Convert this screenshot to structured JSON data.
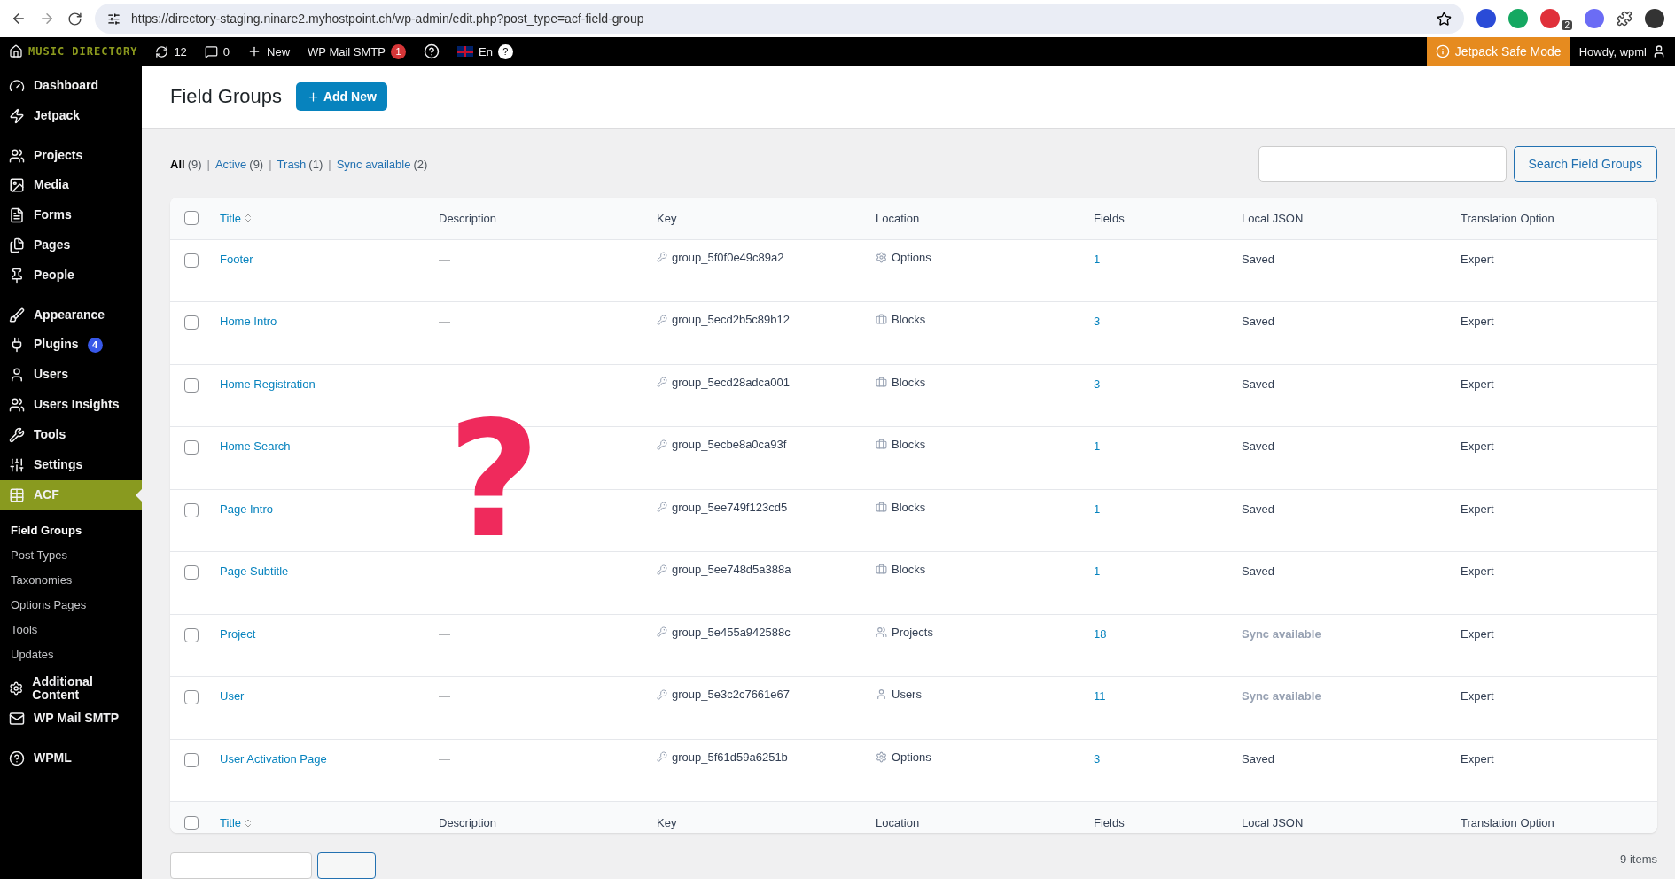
{
  "browser": {
    "url": "https://directory-staging.ninare2.myhostpoint.ch/wp-admin/edit.php?post_type=acf-field-group",
    "extension_badge": "2"
  },
  "admin_bar": {
    "site": "MUSIC DIRECTORY",
    "updates": "12",
    "comments": "0",
    "new": "New",
    "smtp": "WP Mail SMTP",
    "smtp_badge": "1",
    "language": "En",
    "help": "?",
    "safe_mode": "Jetpack Safe Mode",
    "howdy": "Howdy, wpml"
  },
  "sidebar": {
    "items": [
      {
        "label": "Dashboard",
        "selected": false,
        "group_start": false
      },
      {
        "label": "Jetpack",
        "selected": false,
        "group_start": false
      },
      {
        "label": "Projects",
        "selected": false,
        "group_start": true
      },
      {
        "label": "Media",
        "selected": false,
        "group_start": false
      },
      {
        "label": "Forms",
        "selected": false,
        "group_start": false
      },
      {
        "label": "Pages",
        "selected": false,
        "group_start": false
      },
      {
        "label": "People",
        "selected": false,
        "group_start": false
      },
      {
        "label": "Appearance",
        "selected": false,
        "group_start": true
      },
      {
        "label": "Plugins",
        "selected": false,
        "group_start": false,
        "badge": "4"
      },
      {
        "label": "Users",
        "selected": false,
        "group_start": false
      },
      {
        "label": "Users Insights",
        "selected": false,
        "group_start": false
      },
      {
        "label": "Tools",
        "selected": false,
        "group_start": false
      },
      {
        "label": "Settings",
        "selected": false,
        "group_start": false
      },
      {
        "label": "ACF",
        "selected": true,
        "group_start": false,
        "children": [
          {
            "label": "Field Groups",
            "selected": true
          },
          {
            "label": "Post Types",
            "selected": false
          },
          {
            "label": "Taxonomies",
            "selected": false
          },
          {
            "label": "Options Pages",
            "selected": false
          },
          {
            "label": "Tools",
            "selected": false
          },
          {
            "label": "Updates",
            "selected": false
          }
        ]
      },
      {
        "label": "Additional Content",
        "selected": false,
        "group_start": false
      },
      {
        "label": "WP Mail SMTP",
        "selected": false,
        "group_start": false
      },
      {
        "label": "WPML",
        "selected": false,
        "group_start": true
      }
    ]
  },
  "header": {
    "title": "Field Groups",
    "add_button": "Add New"
  },
  "filters": [
    {
      "label": "All",
      "count": "(9)",
      "selected": true
    },
    {
      "separator": "|",
      "label": "Active",
      "count": "(9)",
      "selected": false
    },
    {
      "separator": "|",
      "label": "Trash",
      "count": "(1)",
      "selected": false
    },
    {
      "separator": "|",
      "label": "Sync available",
      "count": "(2)",
      "selected": false
    }
  ],
  "search": {
    "button": "Search Field Groups"
  },
  "table": {
    "select_all_checked": false,
    "columns": [
      "Title",
      "Description",
      "Key",
      "Location",
      "Fields",
      "Local JSON",
      "Translation Option"
    ],
    "rows": [
      {
        "title": "Footer",
        "description": "—",
        "key": "group_5f0f0e49c89a2",
        "location": {
          "label": "Options",
          "kind": "options"
        },
        "fields": "1",
        "local_json": {
          "label": "Saved",
          "dimmed": false
        },
        "translation": "Expert",
        "checked": false
      },
      {
        "title": "Home Intro",
        "description": "—",
        "key": "group_5ecd2b5c89b12",
        "location": {
          "label": "Blocks",
          "kind": "blocks"
        },
        "fields": "3",
        "local_json": {
          "label": "Saved",
          "dimmed": false
        },
        "translation": "Expert",
        "checked": false
      },
      {
        "title": "Home Registration",
        "description": "—",
        "key": "group_5ecd28adca001",
        "location": {
          "label": "Blocks",
          "kind": "blocks"
        },
        "fields": "3",
        "local_json": {
          "label": "Saved",
          "dimmed": false
        },
        "translation": "Expert",
        "checked": false
      },
      {
        "title": "Home Search",
        "key": "group_5ecbe8a0ca93f",
        "location": {
          "label": "Blocks",
          "kind": "blocks"
        },
        "fields": "1",
        "local_json": {
          "label": "Saved",
          "dimmed": false
        },
        "translation": "Expert",
        "checked": false
      },
      {
        "title": "Page Intro",
        "description": "—",
        "key": "group_5ee749f123cd5",
        "location": {
          "label": "Blocks",
          "kind": "blocks"
        },
        "fields": "1",
        "local_json": {
          "label": "Saved",
          "dimmed": false
        },
        "translation": "Expert",
        "checked": false
      },
      {
        "title": "Page Subtitle",
        "description": "—",
        "key": "group_5ee748d5a388a",
        "location": {
          "label": "Blocks",
          "kind": "blocks"
        },
        "fields": "1",
        "local_json": {
          "label": "Saved",
          "dimmed": false
        },
        "translation": "Expert",
        "checked": false
      },
      {
        "title": "Project",
        "description": "—",
        "key": "group_5e455a942588c",
        "location": {
          "label": "Projects",
          "kind": "projects"
        },
        "fields": "18",
        "local_json": {
          "label": "Sync available",
          "dimmed": true
        },
        "translation": "Expert",
        "checked": false
      },
      {
        "title": "User",
        "description": "—",
        "key": "group_5e3c2c7661e67",
        "location": {
          "label": "Users",
          "kind": "users"
        },
        "fields": "11",
        "local_json": {
          "label": "Sync available",
          "dimmed": true
        },
        "translation": "Expert",
        "checked": false
      },
      {
        "title": "User Activation Page",
        "description": "—",
        "key": "group_5f61d59a6251b",
        "location": {
          "label": "Options",
          "kind": "options"
        },
        "fields": "3",
        "local_json": {
          "label": "Saved",
          "dimmed": false
        },
        "translation": "Expert",
        "checked": false
      }
    ],
    "footer_checked": false,
    "footer_columns": [
      "Title",
      "Description",
      "Key",
      "Location",
      "Fields",
      "Local JSON",
      "Translation Option"
    ]
  },
  "item_count": "9 items",
  "overlay_mark": "?"
}
